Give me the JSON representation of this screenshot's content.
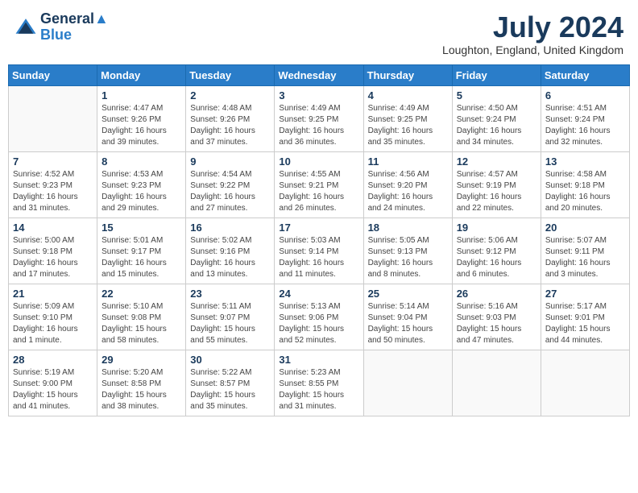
{
  "header": {
    "logo_line1": "General",
    "logo_line2": "Blue",
    "month_title": "July 2024",
    "subtitle": "Loughton, England, United Kingdom"
  },
  "weekdays": [
    "Sunday",
    "Monday",
    "Tuesday",
    "Wednesday",
    "Thursday",
    "Friday",
    "Saturday"
  ],
  "weeks": [
    [
      {
        "day": "",
        "info": ""
      },
      {
        "day": "1",
        "info": "Sunrise: 4:47 AM\nSunset: 9:26 PM\nDaylight: 16 hours\nand 39 minutes."
      },
      {
        "day": "2",
        "info": "Sunrise: 4:48 AM\nSunset: 9:26 PM\nDaylight: 16 hours\nand 37 minutes."
      },
      {
        "day": "3",
        "info": "Sunrise: 4:49 AM\nSunset: 9:25 PM\nDaylight: 16 hours\nand 36 minutes."
      },
      {
        "day": "4",
        "info": "Sunrise: 4:49 AM\nSunset: 9:25 PM\nDaylight: 16 hours\nand 35 minutes."
      },
      {
        "day": "5",
        "info": "Sunrise: 4:50 AM\nSunset: 9:24 PM\nDaylight: 16 hours\nand 34 minutes."
      },
      {
        "day": "6",
        "info": "Sunrise: 4:51 AM\nSunset: 9:24 PM\nDaylight: 16 hours\nand 32 minutes."
      }
    ],
    [
      {
        "day": "7",
        "info": "Sunrise: 4:52 AM\nSunset: 9:23 PM\nDaylight: 16 hours\nand 31 minutes."
      },
      {
        "day": "8",
        "info": "Sunrise: 4:53 AM\nSunset: 9:23 PM\nDaylight: 16 hours\nand 29 minutes."
      },
      {
        "day": "9",
        "info": "Sunrise: 4:54 AM\nSunset: 9:22 PM\nDaylight: 16 hours\nand 27 minutes."
      },
      {
        "day": "10",
        "info": "Sunrise: 4:55 AM\nSunset: 9:21 PM\nDaylight: 16 hours\nand 26 minutes."
      },
      {
        "day": "11",
        "info": "Sunrise: 4:56 AM\nSunset: 9:20 PM\nDaylight: 16 hours\nand 24 minutes."
      },
      {
        "day": "12",
        "info": "Sunrise: 4:57 AM\nSunset: 9:19 PM\nDaylight: 16 hours\nand 22 minutes."
      },
      {
        "day": "13",
        "info": "Sunrise: 4:58 AM\nSunset: 9:18 PM\nDaylight: 16 hours\nand 20 minutes."
      }
    ],
    [
      {
        "day": "14",
        "info": "Sunrise: 5:00 AM\nSunset: 9:18 PM\nDaylight: 16 hours\nand 17 minutes."
      },
      {
        "day": "15",
        "info": "Sunrise: 5:01 AM\nSunset: 9:17 PM\nDaylight: 16 hours\nand 15 minutes."
      },
      {
        "day": "16",
        "info": "Sunrise: 5:02 AM\nSunset: 9:16 PM\nDaylight: 16 hours\nand 13 minutes."
      },
      {
        "day": "17",
        "info": "Sunrise: 5:03 AM\nSunset: 9:14 PM\nDaylight: 16 hours\nand 11 minutes."
      },
      {
        "day": "18",
        "info": "Sunrise: 5:05 AM\nSunset: 9:13 PM\nDaylight: 16 hours\nand 8 minutes."
      },
      {
        "day": "19",
        "info": "Sunrise: 5:06 AM\nSunset: 9:12 PM\nDaylight: 16 hours\nand 6 minutes."
      },
      {
        "day": "20",
        "info": "Sunrise: 5:07 AM\nSunset: 9:11 PM\nDaylight: 16 hours\nand 3 minutes."
      }
    ],
    [
      {
        "day": "21",
        "info": "Sunrise: 5:09 AM\nSunset: 9:10 PM\nDaylight: 16 hours\nand 1 minute."
      },
      {
        "day": "22",
        "info": "Sunrise: 5:10 AM\nSunset: 9:08 PM\nDaylight: 15 hours\nand 58 minutes."
      },
      {
        "day": "23",
        "info": "Sunrise: 5:11 AM\nSunset: 9:07 PM\nDaylight: 15 hours\nand 55 minutes."
      },
      {
        "day": "24",
        "info": "Sunrise: 5:13 AM\nSunset: 9:06 PM\nDaylight: 15 hours\nand 52 minutes."
      },
      {
        "day": "25",
        "info": "Sunrise: 5:14 AM\nSunset: 9:04 PM\nDaylight: 15 hours\nand 50 minutes."
      },
      {
        "day": "26",
        "info": "Sunrise: 5:16 AM\nSunset: 9:03 PM\nDaylight: 15 hours\nand 47 minutes."
      },
      {
        "day": "27",
        "info": "Sunrise: 5:17 AM\nSunset: 9:01 PM\nDaylight: 15 hours\nand 44 minutes."
      }
    ],
    [
      {
        "day": "28",
        "info": "Sunrise: 5:19 AM\nSunset: 9:00 PM\nDaylight: 15 hours\nand 41 minutes."
      },
      {
        "day": "29",
        "info": "Sunrise: 5:20 AM\nSunset: 8:58 PM\nDaylight: 15 hours\nand 38 minutes."
      },
      {
        "day": "30",
        "info": "Sunrise: 5:22 AM\nSunset: 8:57 PM\nDaylight: 15 hours\nand 35 minutes."
      },
      {
        "day": "31",
        "info": "Sunrise: 5:23 AM\nSunset: 8:55 PM\nDaylight: 15 hours\nand 31 minutes."
      },
      {
        "day": "",
        "info": ""
      },
      {
        "day": "",
        "info": ""
      },
      {
        "day": "",
        "info": ""
      }
    ]
  ]
}
